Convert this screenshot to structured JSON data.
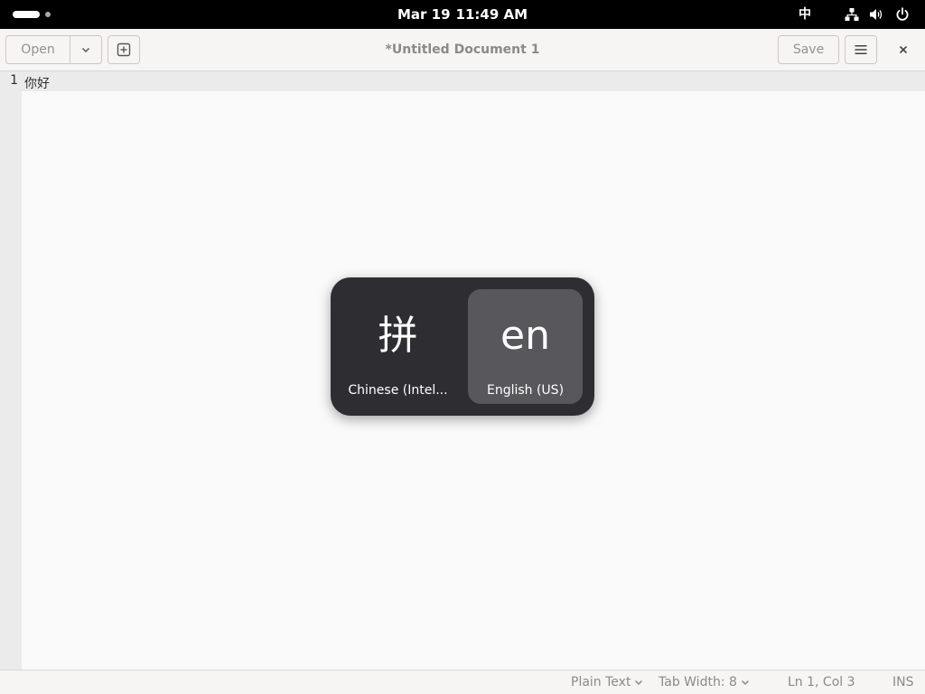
{
  "topbar": {
    "date": "Mar 19",
    "time": "11:49 AM",
    "input_indicator": "中",
    "icons": [
      "network-icon",
      "volume-icon",
      "power-icon"
    ]
  },
  "headerbar": {
    "open_label": "Open",
    "title": "*Untitled Document 1",
    "save_label": "Save",
    "icons": [
      "chevron-down-icon",
      "new-tab-icon",
      "hamburger-menu-icon",
      "close-icon"
    ]
  },
  "editor": {
    "lines": [
      {
        "number": "1",
        "text": "你好"
      }
    ]
  },
  "statusbar": {
    "language": "Plain Text",
    "tab_width": "Tab Width: 8",
    "position": "Ln 1, Col 3",
    "mode": "INS"
  },
  "input_switcher": {
    "items": [
      {
        "symbol": "拼",
        "label": "Chinese (Intel...",
        "selected": false
      },
      {
        "symbol": "en",
        "label": "English (US)",
        "selected": true
      }
    ]
  },
  "colors": {
    "topbar_bg": "#000000",
    "popup_bg": "#2e2e32",
    "popup_selected": "#58585c",
    "editor_bg": "#fafafa"
  }
}
